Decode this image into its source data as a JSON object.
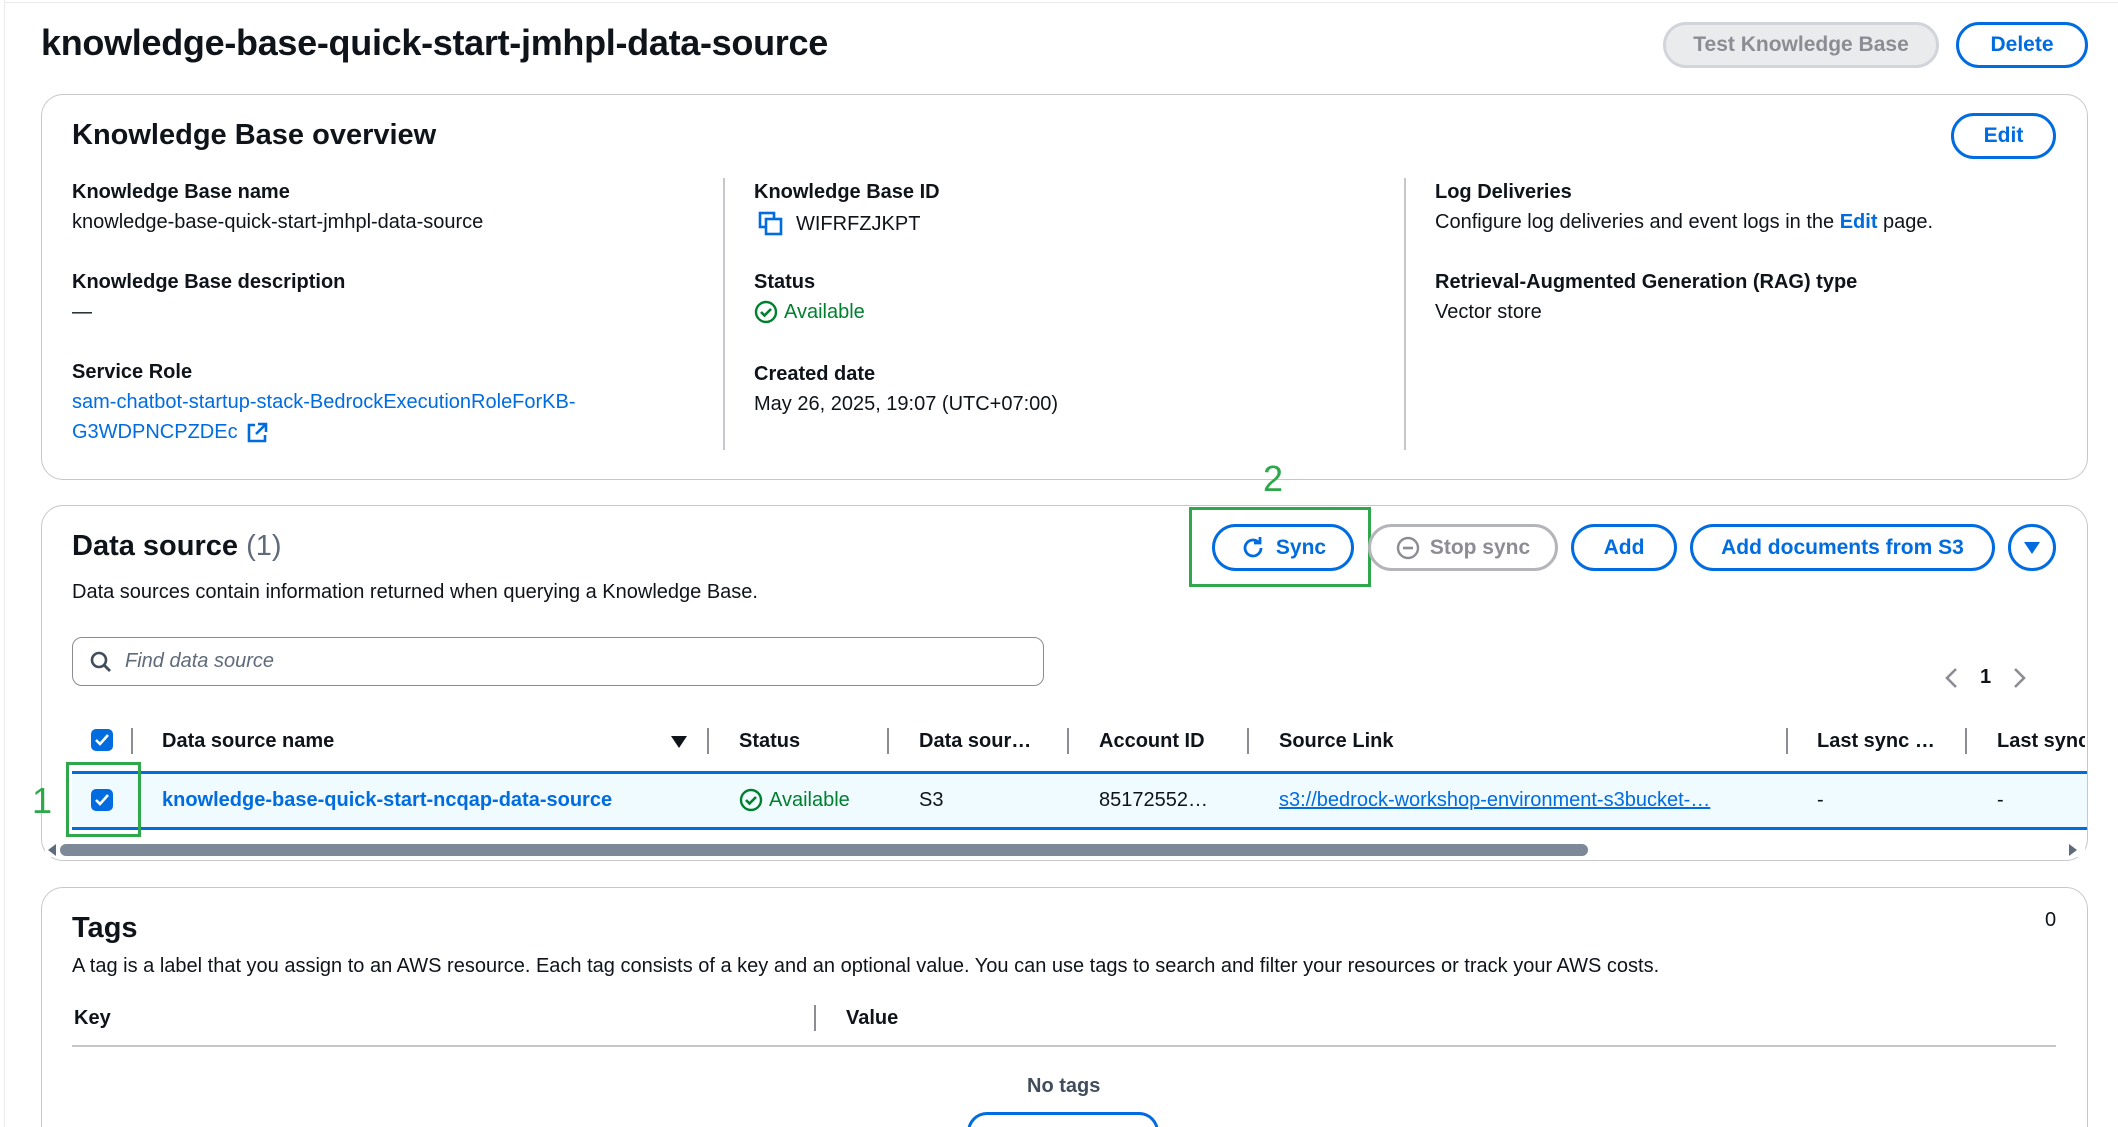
{
  "page": {
    "title": "knowledge-base-quick-start-jmhpl-data-source",
    "test_button": "Test Knowledge Base",
    "delete_button": "Delete"
  },
  "overview": {
    "heading": "Knowledge Base overview",
    "edit_button": "Edit",
    "kb_name_label": "Knowledge Base name",
    "kb_name_value": "knowledge-base-quick-start-jmhpl-data-source",
    "kb_description_label": "Knowledge Base description",
    "kb_description_value": "—",
    "service_role_label": "Service Role",
    "service_role_line1": "sam-chatbot-startup-stack-BedrockExecutionRoleForKB-",
    "service_role_line2": "G3WDPNCPZDEc",
    "kb_id_label": "Knowledge Base ID",
    "kb_id_value": "WIFRFZJKPT",
    "status_label": "Status",
    "status_value": "Available",
    "created_label": "Created date",
    "created_value": "May 26, 2025, 19:07 (UTC+07:00)",
    "log_label": "Log Deliveries",
    "log_text_before": "Configure log deliveries and event logs in the ",
    "log_link": "Edit",
    "log_text_after": " page.",
    "rag_label": "Retrieval-Augmented Generation (RAG) type",
    "rag_value": "Vector store"
  },
  "data_source": {
    "heading": "Data source",
    "count": "(1)",
    "description": "Data sources contain information returned when querying a Knowledge Base.",
    "sync_button": "Sync",
    "stop_sync_button": "Stop sync",
    "add_button": "Add",
    "add_docs_button": "Add documents from S3",
    "search_placeholder": "Find data source",
    "page_number": "1",
    "columns": [
      "Data source name",
      "Status",
      "Data sour…",
      "Account ID",
      "Source Link",
      "Last sync …",
      "Last sync"
    ],
    "row": {
      "name": "knowledge-base-quick-start-ncqap-data-source",
      "status": "Available",
      "type": "S3",
      "account_id": "85172552…",
      "source_link": "s3://bedrock-workshop-environment-s3bucket-…",
      "last_sync_status": "-",
      "last_sync": "-"
    }
  },
  "annotations": {
    "one": "1",
    "two": "2"
  },
  "tags": {
    "heading": "Tags",
    "count": "0",
    "description": "A tag is a label that you assign to an AWS resource. Each tag consists of a key and an optional value. You can use tags to search and filter your resources or track your AWS costs.",
    "key_header": "Key",
    "value_header": "Value",
    "empty_text": "No tags"
  },
  "colors": {
    "primary": "#006ce0",
    "success": "#00802f",
    "annotation": "#2ea84a"
  },
  "icons": [
    "copy-icon",
    "external-link-icon",
    "status-success-icon",
    "refresh-icon",
    "stop-icon",
    "caret-down-icon",
    "search-icon",
    "checkbox-checked-icon",
    "sort-descending-icon",
    "chevron-left-icon",
    "chevron-right-icon"
  ]
}
